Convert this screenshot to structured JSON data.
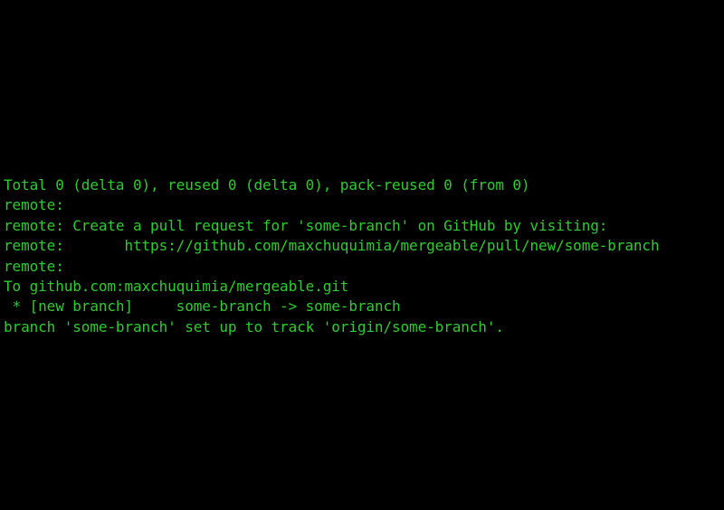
{
  "terminal": {
    "background_color": "#000000",
    "foreground_color": "#2fcc30",
    "lines": [
      "Total 0 (delta 0), reused 0 (delta 0), pack-reused 0 (from 0)",
      "remote: ",
      "remote: Create a pull request for 'some-branch' on GitHub by visiting:",
      "remote:       https://github.com/maxchuquimia/mergeable/pull/new/some-branch",
      "remote: ",
      "To github.com:maxchuquimia/mergeable.git",
      " * [new branch]     some-branch -> some-branch",
      "branch 'some-branch' set up to track 'origin/some-branch'."
    ]
  }
}
